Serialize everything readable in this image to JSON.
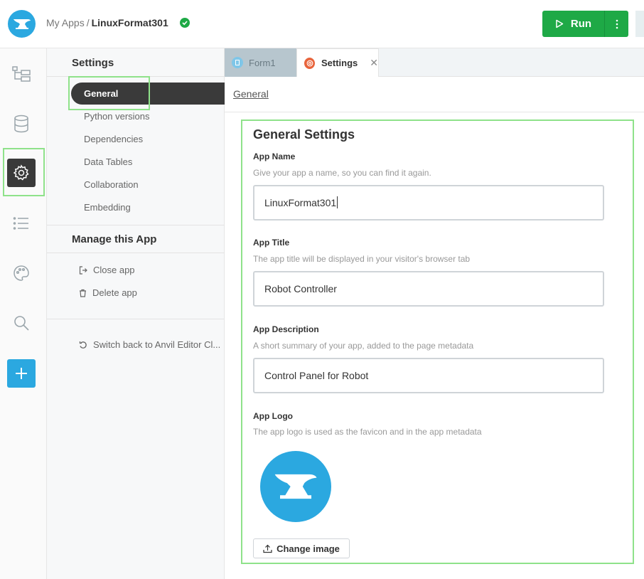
{
  "header": {
    "breadcrumb_root": "My Apps",
    "breadcrumb_sep": "/",
    "app_name": "LinuxFormat301",
    "run_label": "Run"
  },
  "sidebar": {
    "title": "Settings",
    "items": [
      {
        "label": "General",
        "active": true
      },
      {
        "label": "Python versions"
      },
      {
        "label": "Dependencies"
      },
      {
        "label": "Data Tables"
      },
      {
        "label": "Collaboration"
      },
      {
        "label": "Embedding"
      }
    ],
    "manage_title": "Manage this App",
    "close_app": "Close app",
    "delete_app": "Delete app",
    "switch_back": "Switch back to Anvil Editor Cl..."
  },
  "tabs": [
    {
      "label": "Form1",
      "icon": "form-icon"
    },
    {
      "label": "Settings",
      "icon": "gear-icon",
      "active": true
    }
  ],
  "subnav": {
    "link": "General"
  },
  "general": {
    "title": "General Settings",
    "app_name_label": "App Name",
    "app_name_help": "Give your app a name, so you can find it again.",
    "app_name_value": "LinuxFormat301",
    "app_title_label": "App Title",
    "app_title_help": "The app title will be displayed in your visitor's browser tab",
    "app_title_value": "Robot Controller",
    "app_desc_label": "App Description",
    "app_desc_help": "A short summary of your app, added to the page metadata",
    "app_desc_value": "Control Panel for Robot",
    "app_logo_label": "App Logo",
    "app_logo_help": "The app logo is used as the favicon and in the app metadata",
    "change_image": "Change image"
  },
  "colors": {
    "brand": "#2ba8e0",
    "run": "#1ea946",
    "highlight": "#8fe28a"
  }
}
